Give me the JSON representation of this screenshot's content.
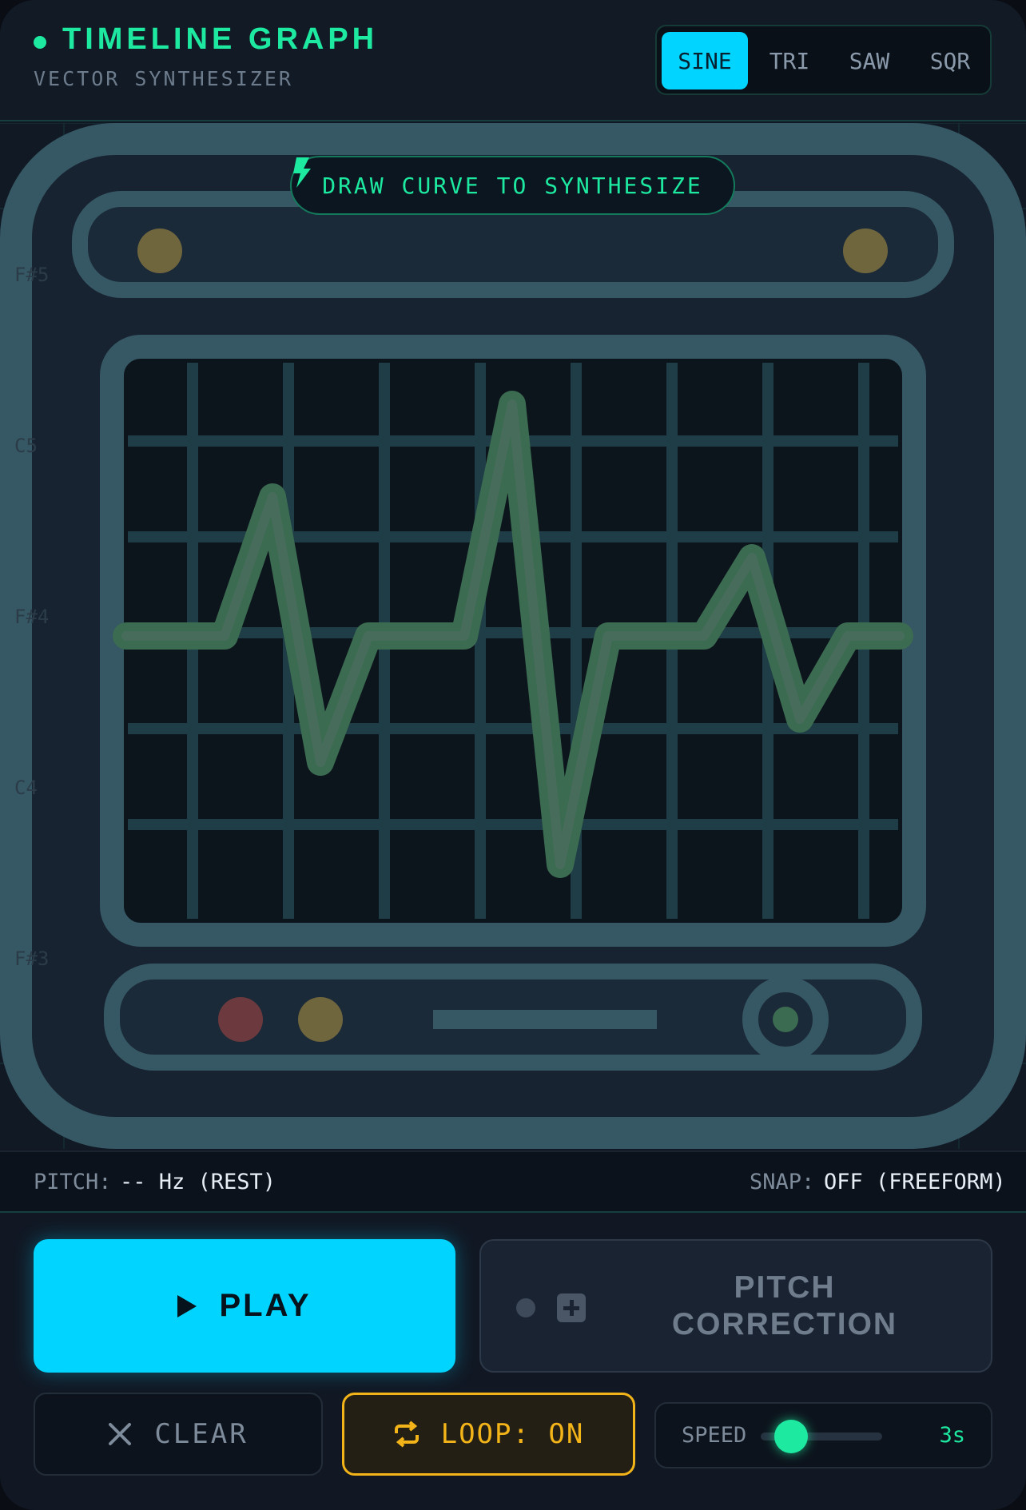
{
  "header": {
    "title": "TIMELINE GRAPH",
    "subtitle": "VECTOR SYNTHESIZER",
    "waveforms": [
      {
        "label": "SINE",
        "active": true
      },
      {
        "label": "TRI",
        "active": false
      },
      {
        "label": "SAW",
        "active": false
      },
      {
        "label": "SQR",
        "active": false
      }
    ]
  },
  "canvas": {
    "hint": "DRAW CURVE TO SYNTHESIZE",
    "hint_icon": "lightning-bolt-icon",
    "note_labels": [
      "F#5",
      "C5",
      "F#4",
      "C4",
      "F#3"
    ],
    "illustration": "monitor-waveform-icon"
  },
  "status": {
    "pitch_label": "PITCH:",
    "pitch_value": "-- Hz (REST)",
    "snap_label": "SNAP:",
    "snap_value": "OFF (FREEFORM)"
  },
  "controls": {
    "play_label": "PLAY",
    "pitch_correction_label": "PITCH\nCORRECTION",
    "clear_label": "CLEAR",
    "loop_label": "LOOP: ON",
    "speed_label": "SPEED",
    "speed_value": "3s",
    "speed_level": 0.25
  },
  "colors": {
    "accent_cyan": "#00d4ff",
    "accent_green": "#1de9a0",
    "accent_amber": "#f2b418",
    "background": "#111824"
  }
}
